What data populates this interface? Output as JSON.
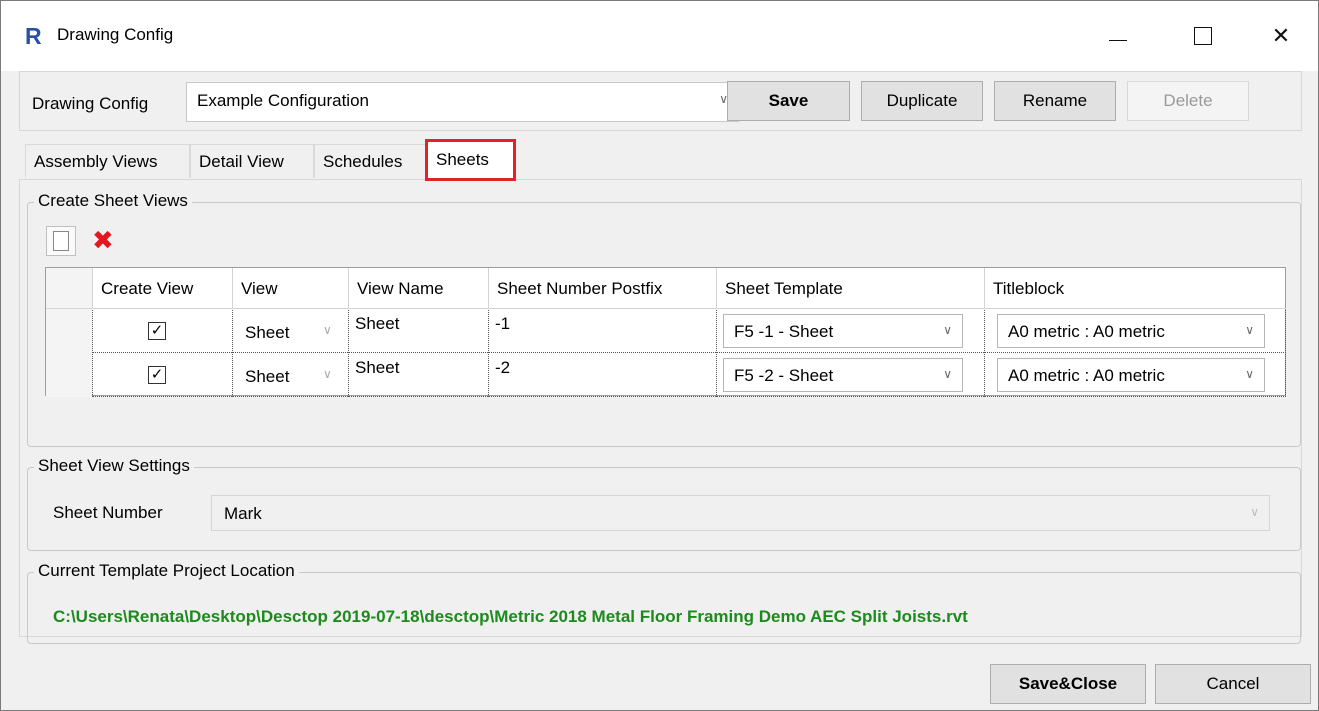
{
  "window": {
    "title": "Drawing Config",
    "app_icon_letter": "R",
    "minimize_label": "",
    "close_glyph": "✕"
  },
  "config": {
    "label": "Drawing Config",
    "selected": "Example Configuration",
    "save_label": "Save",
    "duplicate_label": "Duplicate",
    "rename_label": "Rename",
    "delete_label": "Delete"
  },
  "tabs": [
    {
      "label": "Assembly Views",
      "active": false
    },
    {
      "label": "Detail View",
      "active": false
    },
    {
      "label": "Schedules",
      "active": false
    },
    {
      "label": "Sheets",
      "active": true
    }
  ],
  "create_sheet_views": {
    "legend": "Create Sheet Views",
    "columns": [
      "Create View",
      "View",
      "View Name",
      "Sheet Number Postfix",
      "Sheet Template",
      "Titleblock"
    ],
    "rows": [
      {
        "create_view": true,
        "view": "Sheet",
        "view_name": "Sheet",
        "postfix": "-1",
        "sheet_template": "F5 -1 - Sheet",
        "titleblock": "A0 metric : A0 metric"
      },
      {
        "create_view": true,
        "view": "Sheet",
        "view_name": "Sheet",
        "postfix": "-2",
        "sheet_template": "F5 -2 - Sheet",
        "titleblock": "A0 metric : A0 metric"
      }
    ]
  },
  "sheet_view_settings": {
    "legend": "Sheet View Settings",
    "sheet_number_label": "Sheet Number",
    "sheet_number_value": "Mark"
  },
  "template_location": {
    "legend": "Current Template Project Location",
    "path": "C:\\Users\\Renata\\Desktop\\Desctop 2019-07-18\\desctop\\Metric 2018 Metal Floor Framing Demo AEC Split Joists.rvt",
    "path_color": "#1e8a1e"
  },
  "footer": {
    "save_close_label": "Save&Close",
    "cancel_label": "Cancel"
  },
  "colors": {
    "highlight_border": "#e0232b"
  }
}
